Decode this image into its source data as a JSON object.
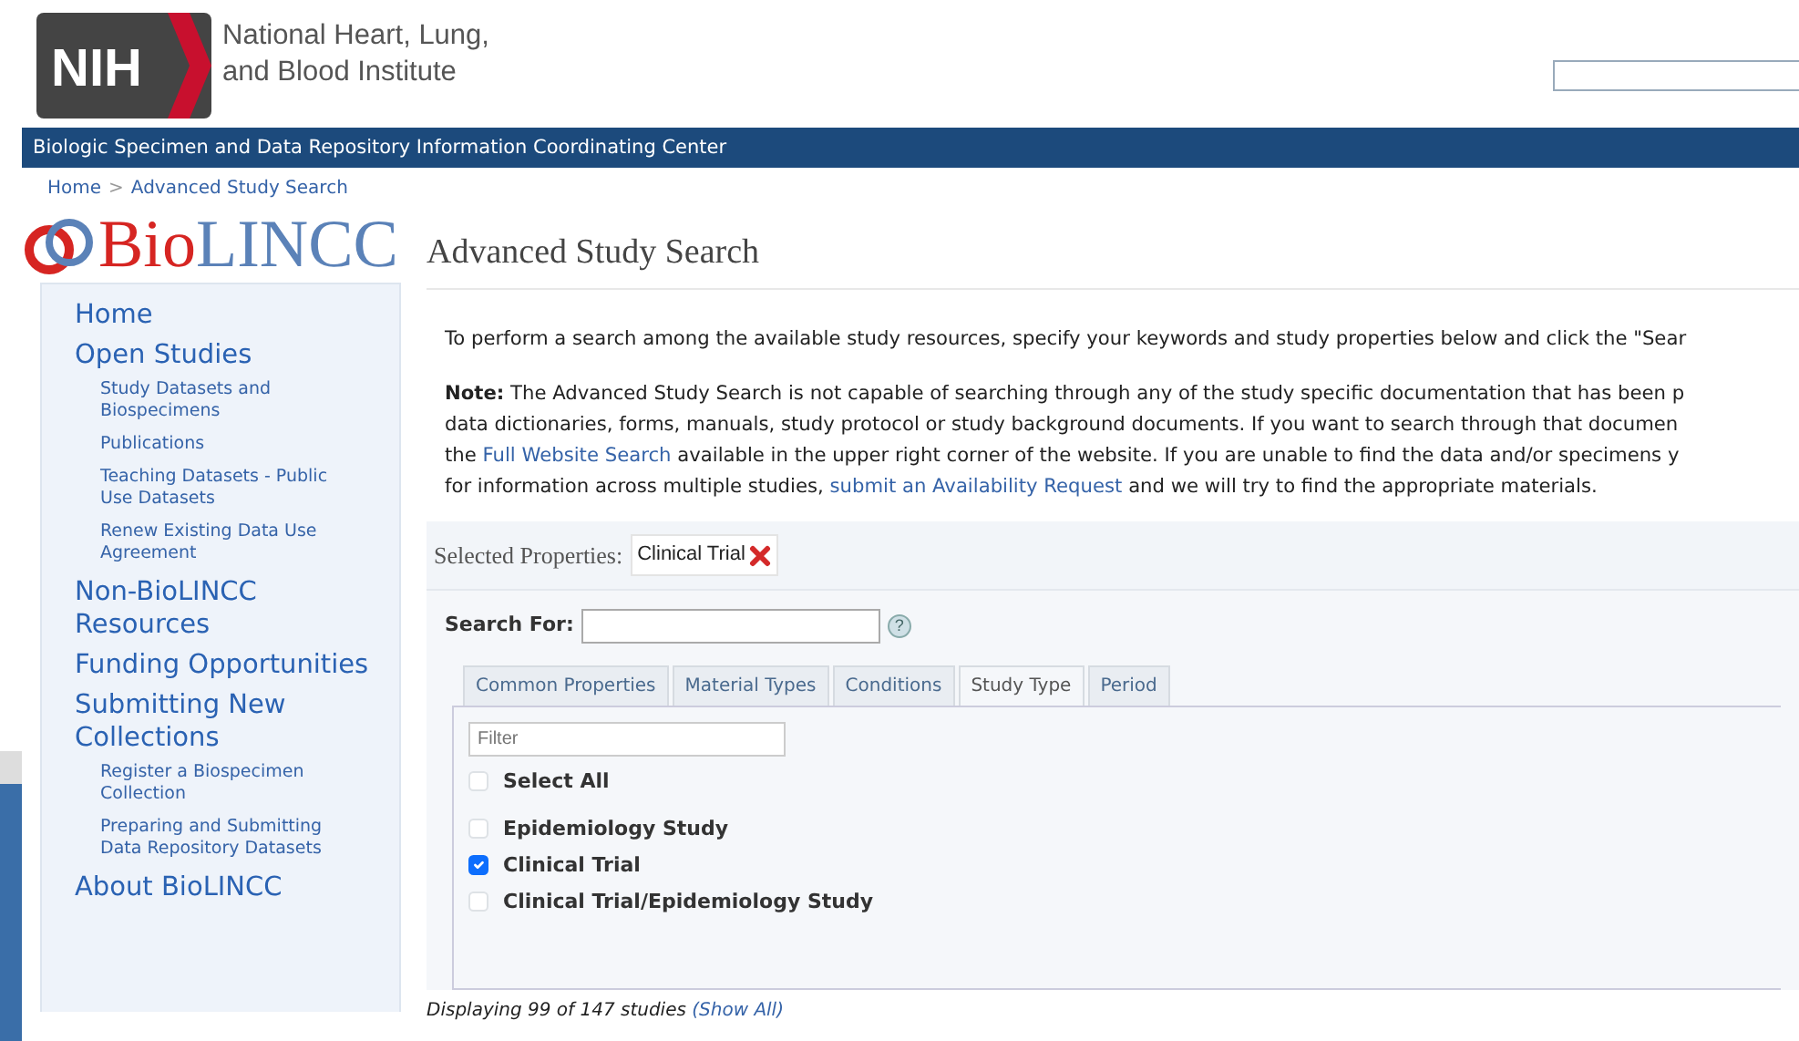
{
  "header": {
    "agency_mark": "NIH",
    "institute_lines": [
      "National Heart, Lung,",
      "and Blood Institute"
    ]
  },
  "banner": "Biologic Specimen and Data Repository Information Coordinating Center",
  "breadcrumb": [
    {
      "label": "Home"
    },
    {
      "label": "Advanced Study Search"
    }
  ],
  "breadcrumb_separator": ">",
  "logo": {
    "part_1": "Bio",
    "part_2": "LINCC"
  },
  "sidebar": {
    "items": [
      {
        "label": "Home"
      },
      {
        "label": "Open Studies",
        "children": [
          {
            "label": "Study Datasets and Biospecimens"
          },
          {
            "label": "Publications"
          },
          {
            "label": "Teaching Datasets - Public Use Datasets"
          },
          {
            "label": "Renew Existing Data Use Agreement"
          }
        ]
      },
      {
        "label": "Non-BioLINCC Resources"
      },
      {
        "label": "Funding Opportunities"
      },
      {
        "label": "Submitting New Collections",
        "children": [
          {
            "label": "Register a Biospecimen Collection"
          },
          {
            "label": "Preparing and Submitting Data Repository Datasets"
          }
        ]
      },
      {
        "label": "About BioLINCC"
      }
    ]
  },
  "page_title": "Advanced Study Search",
  "intro": "To perform a search among the available study resources, specify your keywords and study properties below and click the \"Sear",
  "note_lines": [
    [
      {
        "kind": "text",
        "text": "**Note:** The Advanced Study Search is not capable of searching through any of the study specific documentation that has been p"
      }
    ],
    [
      {
        "kind": "text",
        "text": "data dictionaries, forms, manuals, study protocol or study background documents. If you want to search through that documen"
      }
    ],
    [
      {
        "kind": "text",
        "text": "the "
      },
      {
        "kind": "link",
        "text": "Full Website Search"
      },
      {
        "kind": "text",
        "text": " available in the upper right corner of the website. If you are unable to find the data and/or specimens y"
      }
    ],
    [
      {
        "kind": "text",
        "text": "for information across multiple studies, "
      },
      {
        "kind": "link",
        "text": "submit an Availability Request"
      },
      {
        "kind": "text",
        "text": " and we will try to find the appropriate materials."
      }
    ]
  ],
  "selected_properties": {
    "label": "Selected Properties:",
    "chips": [
      {
        "label": "Clinical Trial"
      }
    ]
  },
  "search": {
    "label": "Search For:",
    "help": "?"
  },
  "tabs": [
    {
      "label": "Common Properties",
      "selected": false
    },
    {
      "label": "Material Types",
      "selected": false
    },
    {
      "label": "Conditions",
      "selected": false
    },
    {
      "label": "Study Type",
      "selected": true
    },
    {
      "label": "Period",
      "selected": false
    }
  ],
  "filter": {
    "placeholder": "Filter"
  },
  "select_all": {
    "label": "Select All",
    "checked": false
  },
  "options": [
    {
      "label": "Epidemiology Study",
      "checked": false
    },
    {
      "label": "Clinical Trial",
      "checked": true
    },
    {
      "label": "Clinical Trial/Epidemiology Study",
      "checked": false
    }
  ],
  "results": {
    "text": "Displaying 99 of 147 studies",
    "link": "(Show All)"
  }
}
